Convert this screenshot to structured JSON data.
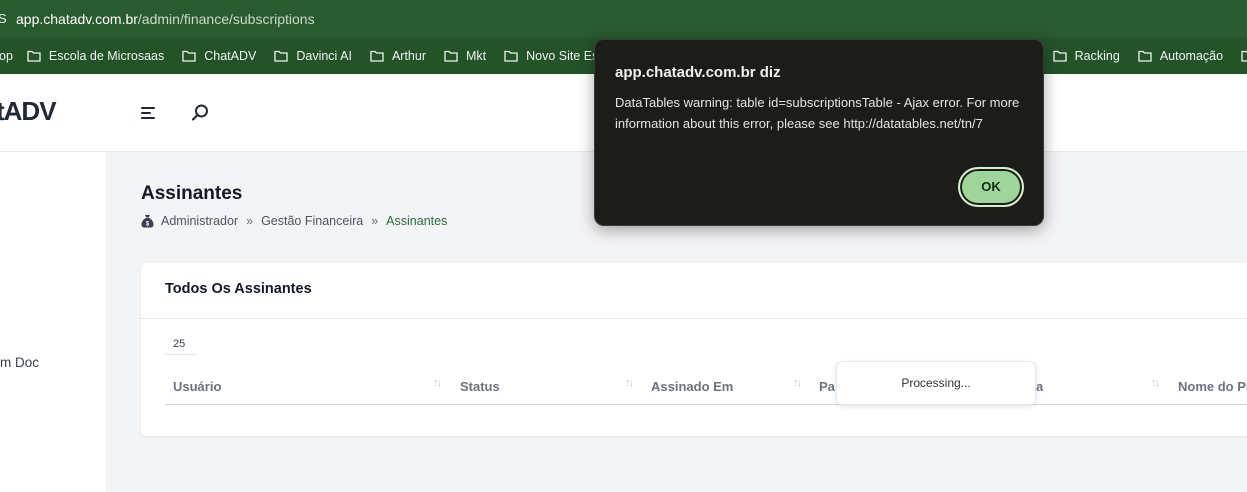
{
  "browser": {
    "address_host": "app.chatadv.com.br",
    "address_path": "/admin/finance/subscriptions",
    "bookmarks": [
      "op",
      "Escola de Microsaas",
      "ChatADV",
      "Davinci AI",
      "Arthur",
      "Mkt",
      "Novo Site Esc",
      "Racking",
      "Automação"
    ]
  },
  "header": {
    "logo": "tADV"
  },
  "sidebar": {
    "item": "m Doc"
  },
  "page": {
    "title": "Assinantes",
    "breadcrumb": [
      "Administrador",
      "Gestão Financeira",
      "Assinantes"
    ],
    "separator": "»"
  },
  "card": {
    "title": "Todos Os Assinantes",
    "page_length": "25",
    "columns": [
      "Usuário",
      "Status",
      "Assinado Em",
      "Pa",
      "a",
      "Nome do Pl"
    ],
    "processing": "Processing..."
  },
  "dialog": {
    "title": "app.chatadv.com.br diz",
    "message": "DataTables warning: table id=subscriptionsTable - Ajax error. For more information about this error, please see http://datatables.net/tn/7",
    "ok_label": "OK"
  },
  "colors": {
    "browser_bar": "#2a5a2f",
    "bookmark_bar": "#24532a",
    "accent_green": "#2f6b3a",
    "dialog_bg": "#1c1d1a",
    "ok_button": "#9fd49a"
  }
}
